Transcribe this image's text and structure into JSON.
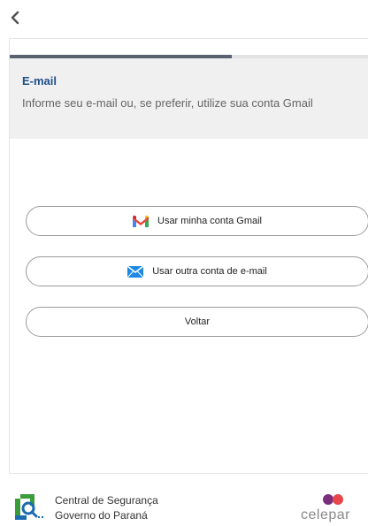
{
  "header": {
    "title": "E-mail",
    "subtitle": "Informe seu e-mail ou, se preferir, utilize sua conta Gmail"
  },
  "progress": {
    "fraction": 0.62
  },
  "actions": {
    "gmail_label": "Usar minha conta Gmail",
    "other_email_label": "Usar outra conta de e-mail",
    "back_label": "Voltar"
  },
  "footer": {
    "org_line1": "Central de Segurança",
    "org_line2": "Governo do Paraná",
    "brand": "celepar"
  },
  "colors": {
    "title": "#1f4f8a",
    "progress_fill": "#5a6270",
    "progress_track": "#e3e3e3",
    "header_band": "#f0f0f0",
    "gov_green": "#3a9d3a",
    "gov_blue": "#1b6bb0",
    "celepar_purple": "#7a2d7a",
    "celepar_red": "#e8464b"
  },
  "icons": {
    "back": "chevron-left-icon",
    "gmail": "gmail-icon",
    "mail": "envelope-icon",
    "gov": "parana-logo-icon"
  }
}
